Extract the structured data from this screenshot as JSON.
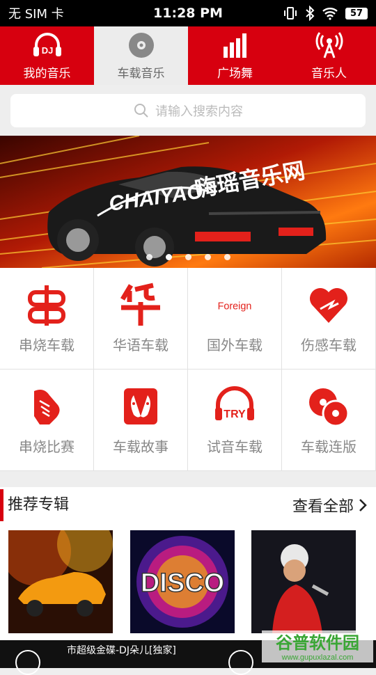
{
  "status": {
    "carrier": "无 SIM 卡",
    "time": "11:28 PM",
    "battery": "57"
  },
  "nav": {
    "tabs": [
      {
        "label": "我的音乐",
        "icon": "dj-headphone-icon",
        "active": false
      },
      {
        "label": "车载音乐",
        "icon": "disc-icon",
        "active": true
      },
      {
        "label": "广场舞",
        "icon": "bar-chart-icon",
        "active": false
      },
      {
        "label": "音乐人",
        "icon": "radio-tower-icon",
        "active": false
      }
    ]
  },
  "search": {
    "placeholder": "请输入搜索内容"
  },
  "banner": {
    "brand": "CHAIYAO",
    "slogan": "嗨瑶音乐网",
    "slides": 5,
    "active_slide": 1
  },
  "categories": [
    {
      "label": "串烧车载",
      "icon": "chuan-icon"
    },
    {
      "label": "华语车载",
      "icon": "hua-icon"
    },
    {
      "label": "国外车载",
      "icon": "foreign-icon",
      "icon_text": "Foreign"
    },
    {
      "label": "伤感车载",
      "icon": "broken-heart-icon"
    },
    {
      "label": "串烧比赛",
      "icon": "handshake-icon"
    },
    {
      "label": "车载故事",
      "icon": "faces-icon"
    },
    {
      "label": "试音车载",
      "icon": "try-headphone-icon",
      "icon_text": "TRY"
    },
    {
      "label": "车载连版",
      "icon": "discs-icon"
    }
  ],
  "recommend": {
    "title": "推荐专辑",
    "more": "查看全部",
    "albums": [
      {
        "name": "orange-sports-car"
      },
      {
        "name": "disco",
        "text": "DISCO"
      },
      {
        "name": "singer-performance"
      }
    ]
  },
  "player": {
    "track": "市超级金碟-DJ朵儿[独家]"
  },
  "watermark": {
    "title": "谷普软件园",
    "url": "www.gupuxlazal.com"
  },
  "colors": {
    "brand_red": "#d7000f",
    "background": "#eeeeee"
  }
}
